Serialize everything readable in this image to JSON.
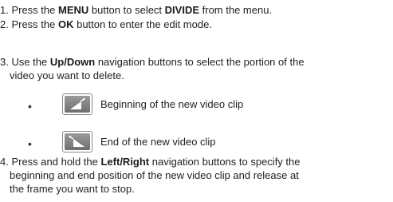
{
  "steps": {
    "s1": {
      "prefix": "1. Press the ",
      "key1": "MENU",
      "mid": " button to select ",
      "key2": "DIVIDE",
      "suffix": " from the menu."
    },
    "s2": {
      "prefix": "2. Press the ",
      "key": "OK",
      "suffix": " button to enter the edit mode."
    },
    "s3": {
      "prefix": "3. Use the ",
      "key": "Up/Down",
      "suffix": " navigation buttons to select the portion of the",
      "line2": "video you want to delete."
    },
    "s4": {
      "prefix": "4. Press and hold the ",
      "key": "Left/Right",
      "suffix": " navigation buttons to specify the",
      "line2": "beginning and end position of the new video clip and release at",
      "line3": "the frame you want to stop."
    }
  },
  "clip_options": [
    {
      "bullet": "•",
      "icon": "clip-begin-icon",
      "label": "Beginning of the new video clip"
    },
    {
      "bullet": "•",
      "icon": "clip-end-icon",
      "label": "End of the new video clip"
    }
  ]
}
